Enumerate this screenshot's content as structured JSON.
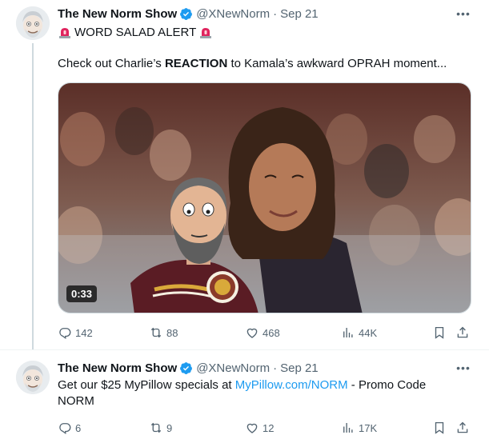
{
  "posts": [
    {
      "author_name": "The New Norm Show",
      "handle": "@XNewNorm",
      "separator": "·",
      "date": "Sep 21",
      "line1": "WORD SALAD ALERT",
      "line2_before": "Check out Charlie’s ",
      "line2_bold": "REACTION",
      "line2_after": " to Kamala’s awkward OPRAH moment...",
      "video_duration": "0:33",
      "stats": {
        "replies": "142",
        "reposts": "88",
        "likes": "468",
        "views": "44K"
      }
    },
    {
      "author_name": "The New Norm Show",
      "handle": "@XNewNorm",
      "separator": "·",
      "date": "Sep 21",
      "text_before": "Get our $25 MyPillow specials at ",
      "link_text": "MyPillow.com/NORM",
      "text_after": " - Promo Code NORM",
      "stats": {
        "replies": "6",
        "reposts": "9",
        "likes": "12",
        "views": "17K"
      }
    }
  ],
  "icons": {
    "verified": "verified-badge-icon",
    "siren": "police-siren-icon",
    "more": "more-options-icon",
    "reply": "reply-icon",
    "repost": "repost-icon",
    "like": "heart-icon",
    "views": "views-chart-icon",
    "bookmark": "bookmark-icon",
    "share": "share-icon"
  },
  "colors": {
    "verified": "#1d9bf0",
    "link": "#1d9bf0",
    "muted": "#536471",
    "siren": "#e0245e"
  }
}
